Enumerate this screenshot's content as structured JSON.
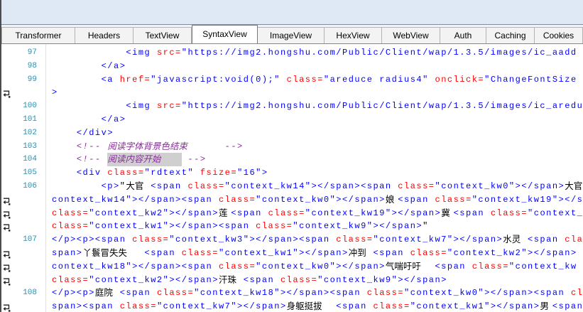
{
  "tabs": [
    {
      "label": "Transformer"
    },
    {
      "label": "Headers"
    },
    {
      "label": "TextView"
    },
    {
      "label": "SyntaxView",
      "selected": true
    },
    {
      "label": "ImageView"
    },
    {
      "label": "HexView"
    },
    {
      "label": "WebView"
    },
    {
      "label": "Auth"
    },
    {
      "label": "Caching"
    },
    {
      "label": "Cookies"
    }
  ],
  "colors": {
    "tag": "#0000ff",
    "attr": "#ff0000",
    "value": "#0000ff",
    "text": "#000000",
    "comment": "#8a2e9a",
    "selection_bg": "#cfcfcf",
    "line_number": "#2b91af",
    "top_panel": "#dfe9f5"
  },
  "code": {
    "wrap_icon": "word-wrap-icon",
    "rows": [
      {
        "num": "97",
        "text": "            <img src=\"https://img2.hongshu.com/Public/Client/wap/1.3.5/images/ic_aadd"
      },
      {
        "num": "98",
        "text": "        </a>"
      },
      {
        "num": "99",
        "text": "        <a href=\"javascript:void(0);\" class=\"areduce radius4\" onclick=\"ChangeFontSize"
      },
      {
        "wrap": true,
        "text": ">"
      },
      {
        "num": "100",
        "text": "            <img src=\"https://img2.hongshu.com/Public/Client/wap/1.3.5/images/ic_aredu"
      },
      {
        "num": "101",
        "text": "        </a>"
      },
      {
        "num": "102",
        "text": "    </div>"
      },
      {
        "num": "103",
        "text": "    <!-- 阅读字体背景色结束 -->"
      },
      {
        "num": "104",
        "text": "    <!-- 阅读内容开始 -->"
      },
      {
        "num": "105",
        "text": "    <div class=\"rdtext\" fsize=\"16\">"
      },
      {
        "num": "106",
        "text": "        <p>\"大官<span class=\"context_kw14\"></span><span class=\"context_kw0\"></span>大官"
      },
      {
        "wrap": true,
        "text": "context_kw14\"></span><span class=\"context_kw0\"></span>娘<span class=\"context_kw19\"></s"
      },
      {
        "wrap": true,
        "text": "class=\"context_kw2\"></span>莲<span class=\"context_kw19\"></span>冀<span class=\"context_"
      },
      {
        "wrap": true,
        "text": "class=\"context_kw1\"></span><span class=\"context_kw9\"></span>\""
      },
      {
        "num": "107",
        "text": "</p><p><span class=\"context_kw3\"></span><span class=\"context_kw7\"></span>水灵<span cla"
      },
      {
        "wrap": true,
        "text": "span>丫鬟冒失失<span class=\"context_kw1\"></span>冲到<span class=\"context_kw2\"></span>"
      },
      {
        "wrap": true,
        "text": "context_kw18\"></span><span class=\"context_kw0\"></span>气喘吁吁<span class=\"context_kw"
      },
      {
        "wrap": true,
        "text": "class=\"context_kw2\"></span>汗珠<span class=\"context_kw9\"></span>"
      },
      {
        "num": "108",
        "text": "</p><p>庭院<span class=\"context_kw18\"></span><span class=\"context_kw0\"></span><span cl"
      },
      {
        "wrap": true,
        "text": "span><span class=\"context_kw7\"></span>身躯挺拔<span class=\"context_kw1\"></span>男<span"
      }
    ],
    "selection": {
      "row": 8,
      "text": "阅读内容开始"
    }
  }
}
